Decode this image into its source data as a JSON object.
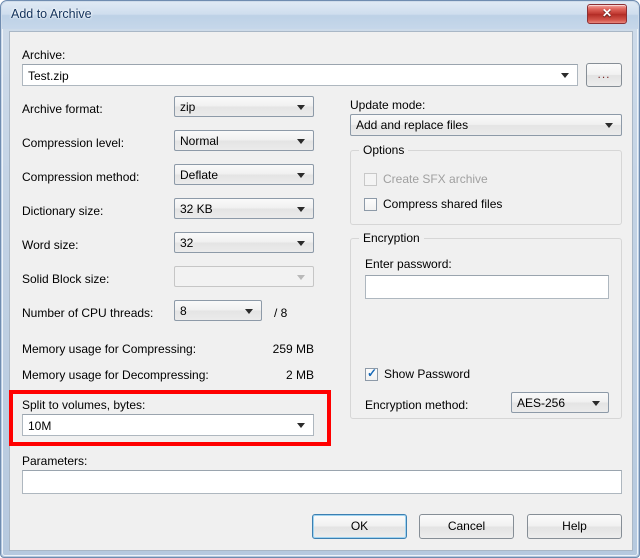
{
  "window": {
    "title": "Add to Archive",
    "close_icon": "close-icon",
    "close_glyph": "✕"
  },
  "archive": {
    "label": "Archive:",
    "value": "Test.zip",
    "browse_label": "...",
    "dropdown_icon": "chevron-down-icon"
  },
  "left_column": {
    "archive_format": {
      "label": "Archive format:",
      "value": "zip"
    },
    "compression_level": {
      "label": "Compression level:",
      "value": "Normal"
    },
    "compression_method": {
      "label": "Compression method:",
      "value": "Deflate"
    },
    "dictionary_size": {
      "label": "Dictionary size:",
      "value": "32 KB"
    },
    "word_size": {
      "label": "Word size:",
      "value": "32"
    },
    "solid_block_size": {
      "label": "Solid Block size:",
      "value": "",
      "disabled": true
    },
    "cpu_threads": {
      "label": "Number of CPU threads:",
      "value": "8",
      "total": "/ 8"
    },
    "memory_compressing": {
      "label": "Memory usage for Compressing:",
      "value": "259 MB"
    },
    "memory_decompressing": {
      "label": "Memory usage for Decompressing:",
      "value": "2 MB"
    },
    "split_volumes": {
      "label": "Split to volumes, bytes:",
      "value": "10M"
    },
    "parameters": {
      "label": "Parameters:",
      "value": ""
    }
  },
  "right_column": {
    "update_mode": {
      "label": "Update mode:",
      "value": "Add and replace files"
    },
    "options_group": {
      "title": "Options",
      "items": [
        {
          "label": "Create SFX archive",
          "checked": false,
          "disabled": true
        },
        {
          "label": "Compress shared files",
          "checked": false,
          "disabled": false
        }
      ]
    },
    "encryption_group": {
      "title": "Encryption",
      "password_label": "Enter password:",
      "password_value": "",
      "show_password": {
        "label": "Show Password",
        "checked": true
      },
      "encryption_method": {
        "label": "Encryption method:",
        "value": "AES-256"
      }
    }
  },
  "buttons": {
    "ok": "OK",
    "cancel": "Cancel",
    "help": "Help"
  },
  "annotation": {
    "highlight_color": "#ff0000",
    "highlight_target": "split-to-volumes-row"
  }
}
